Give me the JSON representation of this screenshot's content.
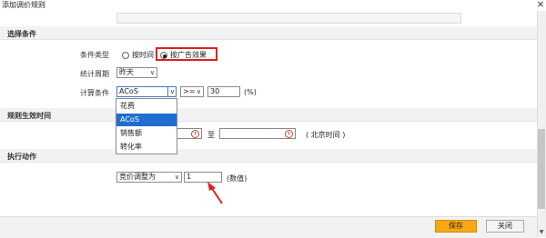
{
  "dialog": {
    "title": "添加调价规则",
    "close_glyph": "×"
  },
  "sections": {
    "conditions": "选择条件",
    "effective_time": "规则生效时间",
    "actions": "执行动作"
  },
  "condition_type": {
    "label": "条件类型",
    "option_time": "按时间",
    "option_ad": "按广告效果",
    "selected": "按广告效果"
  },
  "stat_period": {
    "label": "统计周期",
    "value": "昨天"
  },
  "calc_condition": {
    "label": "计算条件",
    "metric": "ACoS",
    "operator": ">=",
    "value": "30",
    "unit": "(%)"
  },
  "metric_dropdown": {
    "options": [
      "花费",
      "ACoS",
      "销售额",
      "转化率"
    ],
    "selected_index": 1
  },
  "effective_time": {
    "to_label": "至",
    "timezone_note": "( 北京时间 )"
  },
  "action": {
    "type": "竞价调整为",
    "value": "1",
    "unit": "(数值)"
  },
  "footer": {
    "save": "保存",
    "close": "关闭"
  },
  "colors": {
    "highlight": "#e02020",
    "save_button": "#f6a814",
    "dropdown_selected": "#1e6fd0"
  }
}
